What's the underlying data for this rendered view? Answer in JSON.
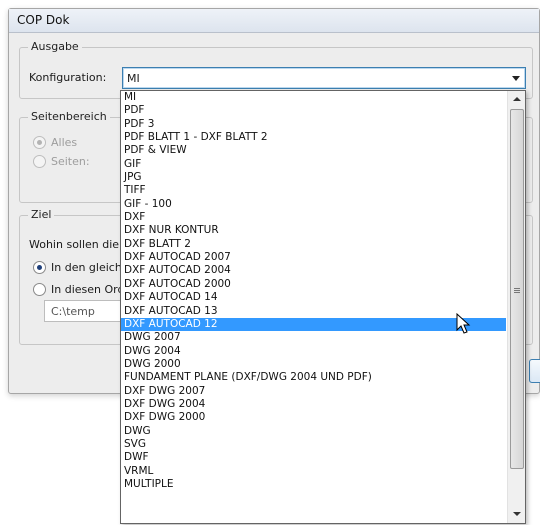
{
  "window": {
    "title": "COP Dok"
  },
  "ausgabe": {
    "legend": "Ausgabe",
    "konfiguration_label": "Konfiguration:",
    "konfiguration_value": "MI"
  },
  "seitenbereich": {
    "legend": "Seitenbereich",
    "option_alles": "Alles",
    "option_seiten": "Seiten:"
  },
  "ziel": {
    "legend": "Ziel",
    "question": "Wohin sollen die",
    "option_gleiche": "In den gleiche",
    "option_ordner": "In diesen Ord",
    "path_value": "C:\\temp"
  },
  "dropdown": {
    "selected_index": 17,
    "items": [
      "MI",
      "PDF",
      "PDF 3",
      "PDF BLATT 1 - DXF BLATT 2",
      "PDF & VIEW",
      "GIF",
      "JPG",
      "TIFF",
      "GIF - 100",
      "DXF",
      "DXF NUR KONTUR",
      "DXF BLATT 2",
      "DXF AUTOCAD 2007",
      "DXF AUTOCAD 2004",
      "DXF AUTOCAD 2000",
      "DXF AUTOCAD 14",
      "DXF AUTOCAD 13",
      "DXF AUTOCAD 12",
      "DWG 2007",
      "DWG 2004",
      "DWG 2000",
      "FUNDAMENT PLÄNE (DXF/DWG 2004 UND PDF)",
      "DXF DWG 2007",
      "DXF DWG 2004",
      "DXF DWG 2000",
      "DWG",
      "SVG",
      "DWF",
      "VRML",
      "MULTIPLE"
    ]
  },
  "colors": {
    "selection": "#3399ff",
    "focus_border": "#3c7fb1",
    "dialog_bg": "#ededed"
  }
}
